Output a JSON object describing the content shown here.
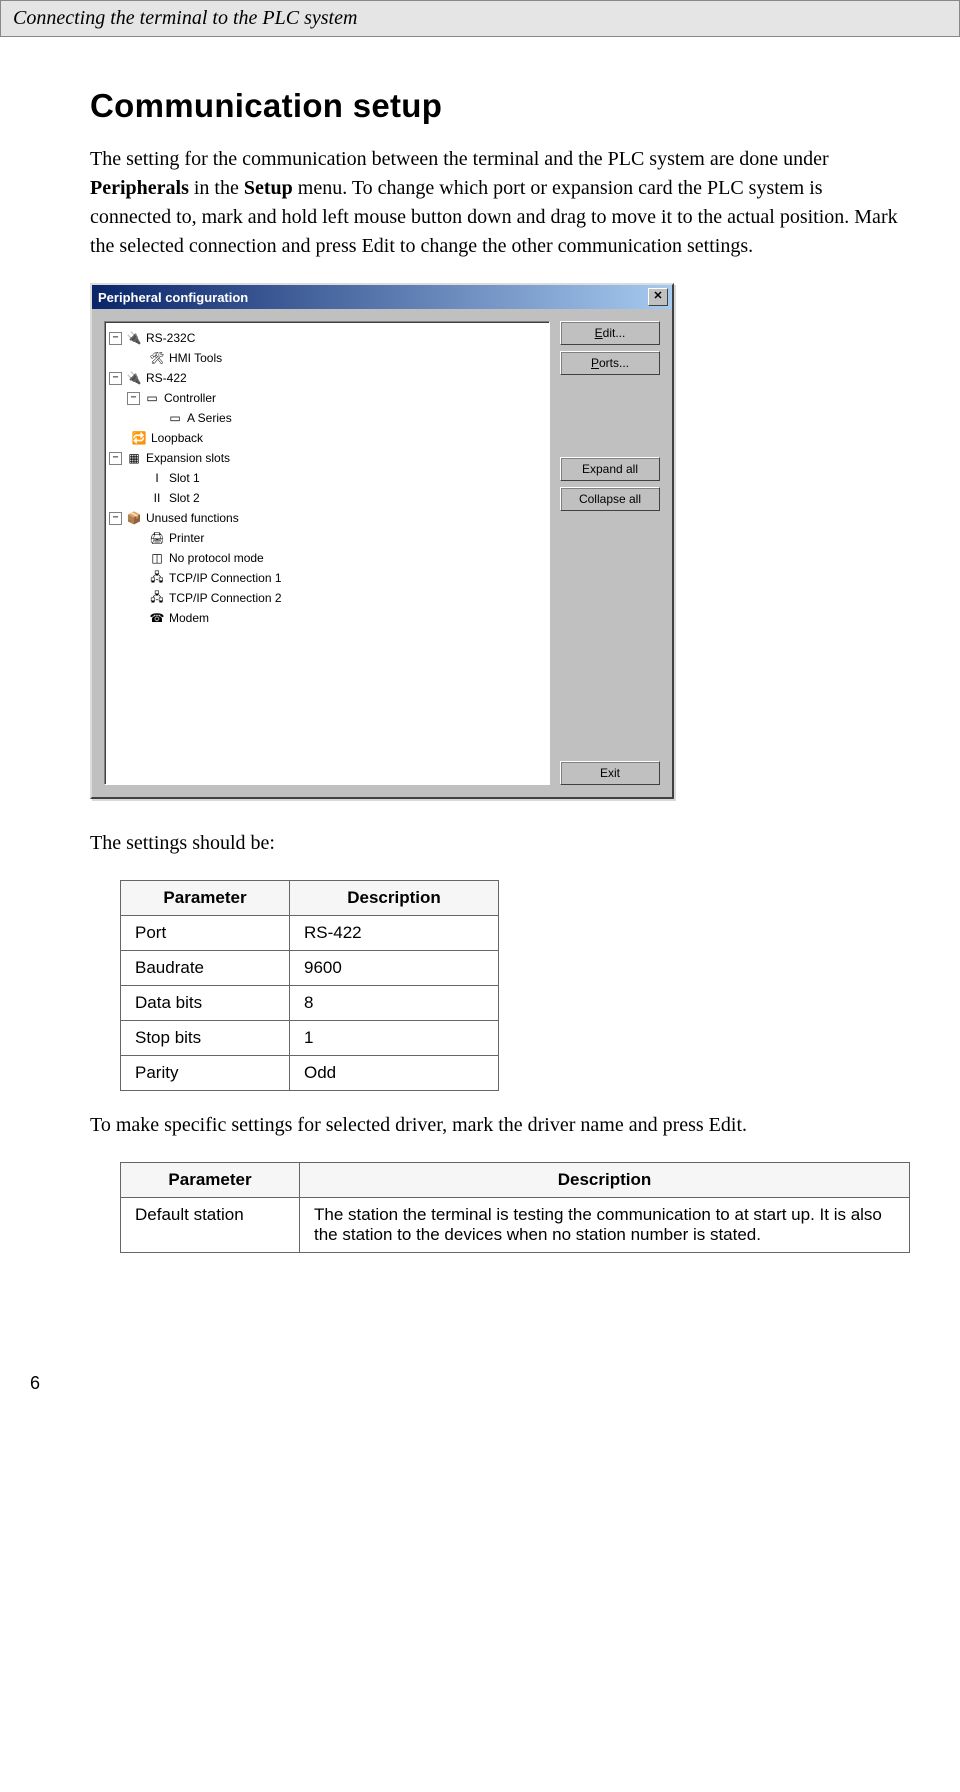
{
  "header": "Connecting the terminal to the PLC system",
  "title": "Communication setup",
  "para1a": "The setting for the communication between the terminal and the PLC system are done under ",
  "para1b": "Peripherals",
  "para1c": " in the ",
  "para1d": "Setup",
  "para1e": " menu. To change which port or expansion card the PLC system is connected to, mark and hold left mouse button down and drag to move it to the actual position. Mark the selected connection and press Edit to change the other communication settings.",
  "dialog": {
    "title": "Peripheral configuration",
    "close": "✕",
    "buttons": {
      "edit": "Edit...",
      "ports": "Ports...",
      "expand": "Expand all",
      "collapse": "Collapse all",
      "exit": "Exit"
    },
    "tree": {
      "n0": "RS-232C",
      "n1": "HMI Tools",
      "n2": "RS-422",
      "n3": "Controller",
      "n4": "A Series",
      "n5": "Loopback",
      "n6": "Expansion slots",
      "n7": "Slot 1",
      "n8": "Slot 2",
      "n9": "Unused functions",
      "n10": "Printer",
      "n11": "No protocol mode",
      "n12": "TCP/IP Connection 1",
      "n13": "TCP/IP Connection 2",
      "n14": "Modem"
    }
  },
  "settings_intro": "The settings should be:",
  "table1": {
    "h1": "Parameter",
    "h2": "Description",
    "rows": [
      {
        "p": "Port",
        "d": "RS-422"
      },
      {
        "p": "Baudrate",
        "d": "9600"
      },
      {
        "p": "Data bits",
        "d": "8"
      },
      {
        "p": "Stop bits",
        "d": "1"
      },
      {
        "p": "Parity",
        "d": "Odd"
      }
    ]
  },
  "para2": "To make specific settings for selected driver, mark the driver name and press Edit.",
  "table2": {
    "h1": "Parameter",
    "h2": "Description",
    "rows": [
      {
        "p": "Default station",
        "d": "The station the terminal is testing the communication to at start up. It is also the station to the devices when no station number is stated."
      }
    ]
  },
  "page_num": "6"
}
